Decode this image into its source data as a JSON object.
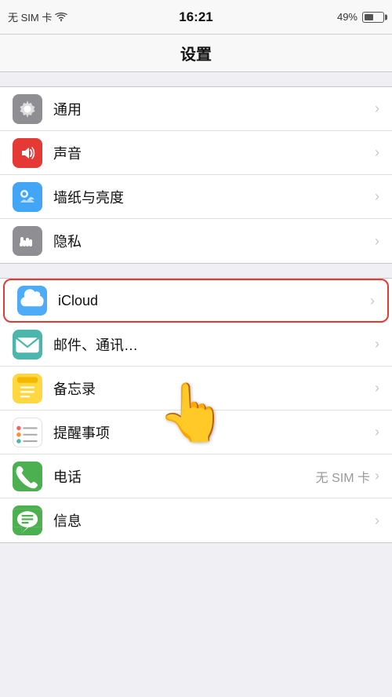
{
  "statusBar": {
    "carrier": "无 SIM 卡",
    "wifi": "wifi",
    "time": "16:21",
    "battery": "49%"
  },
  "pageTitle": "设置",
  "groups": [
    {
      "items": [
        {
          "id": "general",
          "label": "通用",
          "iconColor": "#8e8e93",
          "sublabel": ""
        },
        {
          "id": "sound",
          "label": "声音",
          "iconColor": "#e53935",
          "sublabel": ""
        },
        {
          "id": "wallpaper",
          "label": "墙纸与亮度",
          "iconColor": "#42a5f5",
          "sublabel": ""
        },
        {
          "id": "privacy",
          "label": "隐私",
          "iconColor": "#8e8e93",
          "sublabel": ""
        }
      ]
    },
    {
      "items": [
        {
          "id": "icloud",
          "label": "iCloud",
          "iconColor": "#4dabf7",
          "sublabel": "",
          "highlighted": true
        },
        {
          "id": "mail",
          "label": "邮件、通讯…",
          "iconColor": "#4db6ac",
          "sublabel": ""
        },
        {
          "id": "notes",
          "label": "备忘录",
          "iconColor": "#ffd740",
          "sublabel": ""
        },
        {
          "id": "reminders",
          "label": "提醒事项",
          "iconColor": "#ffffff",
          "sublabel": ""
        },
        {
          "id": "phone",
          "label": "电话",
          "iconColor": "#4caf50",
          "sublabel": "无 SIM 卡"
        },
        {
          "id": "messages",
          "label": "信息",
          "iconColor": "#4caf50",
          "sublabel": ""
        }
      ]
    }
  ]
}
